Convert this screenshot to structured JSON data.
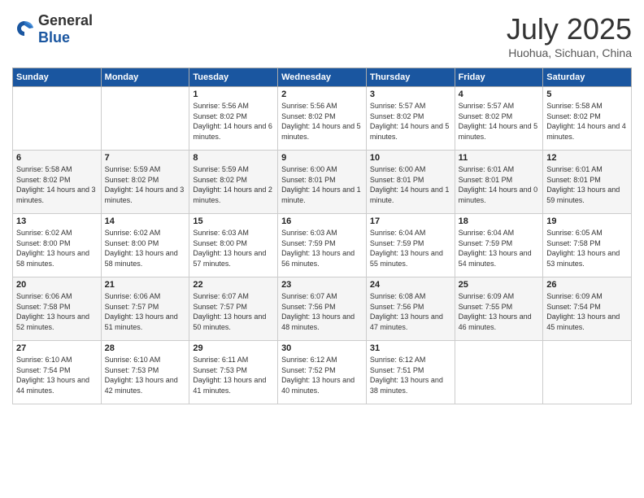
{
  "header": {
    "logo_general": "General",
    "logo_blue": "Blue",
    "month_title": "July 2025",
    "location": "Huohua, Sichuan, China"
  },
  "days_of_week": [
    "Sunday",
    "Monday",
    "Tuesday",
    "Wednesday",
    "Thursday",
    "Friday",
    "Saturday"
  ],
  "weeks": [
    [
      {
        "day": "",
        "info": ""
      },
      {
        "day": "",
        "info": ""
      },
      {
        "day": "1",
        "info": "Sunrise: 5:56 AM\nSunset: 8:02 PM\nDaylight: 14 hours and 6 minutes."
      },
      {
        "day": "2",
        "info": "Sunrise: 5:56 AM\nSunset: 8:02 PM\nDaylight: 14 hours and 5 minutes."
      },
      {
        "day": "3",
        "info": "Sunrise: 5:57 AM\nSunset: 8:02 PM\nDaylight: 14 hours and 5 minutes."
      },
      {
        "day": "4",
        "info": "Sunrise: 5:57 AM\nSunset: 8:02 PM\nDaylight: 14 hours and 5 minutes."
      },
      {
        "day": "5",
        "info": "Sunrise: 5:58 AM\nSunset: 8:02 PM\nDaylight: 14 hours and 4 minutes."
      }
    ],
    [
      {
        "day": "6",
        "info": "Sunrise: 5:58 AM\nSunset: 8:02 PM\nDaylight: 14 hours and 3 minutes."
      },
      {
        "day": "7",
        "info": "Sunrise: 5:59 AM\nSunset: 8:02 PM\nDaylight: 14 hours and 3 minutes."
      },
      {
        "day": "8",
        "info": "Sunrise: 5:59 AM\nSunset: 8:02 PM\nDaylight: 14 hours and 2 minutes."
      },
      {
        "day": "9",
        "info": "Sunrise: 6:00 AM\nSunset: 8:01 PM\nDaylight: 14 hours and 1 minute."
      },
      {
        "day": "10",
        "info": "Sunrise: 6:00 AM\nSunset: 8:01 PM\nDaylight: 14 hours and 1 minute."
      },
      {
        "day": "11",
        "info": "Sunrise: 6:01 AM\nSunset: 8:01 PM\nDaylight: 14 hours and 0 minutes."
      },
      {
        "day": "12",
        "info": "Sunrise: 6:01 AM\nSunset: 8:01 PM\nDaylight: 13 hours and 59 minutes."
      }
    ],
    [
      {
        "day": "13",
        "info": "Sunrise: 6:02 AM\nSunset: 8:00 PM\nDaylight: 13 hours and 58 minutes."
      },
      {
        "day": "14",
        "info": "Sunrise: 6:02 AM\nSunset: 8:00 PM\nDaylight: 13 hours and 58 minutes."
      },
      {
        "day": "15",
        "info": "Sunrise: 6:03 AM\nSunset: 8:00 PM\nDaylight: 13 hours and 57 minutes."
      },
      {
        "day": "16",
        "info": "Sunrise: 6:03 AM\nSunset: 7:59 PM\nDaylight: 13 hours and 56 minutes."
      },
      {
        "day": "17",
        "info": "Sunrise: 6:04 AM\nSunset: 7:59 PM\nDaylight: 13 hours and 55 minutes."
      },
      {
        "day": "18",
        "info": "Sunrise: 6:04 AM\nSunset: 7:59 PM\nDaylight: 13 hours and 54 minutes."
      },
      {
        "day": "19",
        "info": "Sunrise: 6:05 AM\nSunset: 7:58 PM\nDaylight: 13 hours and 53 minutes."
      }
    ],
    [
      {
        "day": "20",
        "info": "Sunrise: 6:06 AM\nSunset: 7:58 PM\nDaylight: 13 hours and 52 minutes."
      },
      {
        "day": "21",
        "info": "Sunrise: 6:06 AM\nSunset: 7:57 PM\nDaylight: 13 hours and 51 minutes."
      },
      {
        "day": "22",
        "info": "Sunrise: 6:07 AM\nSunset: 7:57 PM\nDaylight: 13 hours and 50 minutes."
      },
      {
        "day": "23",
        "info": "Sunrise: 6:07 AM\nSunset: 7:56 PM\nDaylight: 13 hours and 48 minutes."
      },
      {
        "day": "24",
        "info": "Sunrise: 6:08 AM\nSunset: 7:56 PM\nDaylight: 13 hours and 47 minutes."
      },
      {
        "day": "25",
        "info": "Sunrise: 6:09 AM\nSunset: 7:55 PM\nDaylight: 13 hours and 46 minutes."
      },
      {
        "day": "26",
        "info": "Sunrise: 6:09 AM\nSunset: 7:54 PM\nDaylight: 13 hours and 45 minutes."
      }
    ],
    [
      {
        "day": "27",
        "info": "Sunrise: 6:10 AM\nSunset: 7:54 PM\nDaylight: 13 hours and 44 minutes."
      },
      {
        "day": "28",
        "info": "Sunrise: 6:10 AM\nSunset: 7:53 PM\nDaylight: 13 hours and 42 minutes."
      },
      {
        "day": "29",
        "info": "Sunrise: 6:11 AM\nSunset: 7:53 PM\nDaylight: 13 hours and 41 minutes."
      },
      {
        "day": "30",
        "info": "Sunrise: 6:12 AM\nSunset: 7:52 PM\nDaylight: 13 hours and 40 minutes."
      },
      {
        "day": "31",
        "info": "Sunrise: 6:12 AM\nSunset: 7:51 PM\nDaylight: 13 hours and 38 minutes."
      },
      {
        "day": "",
        "info": ""
      },
      {
        "day": "",
        "info": ""
      }
    ]
  ]
}
